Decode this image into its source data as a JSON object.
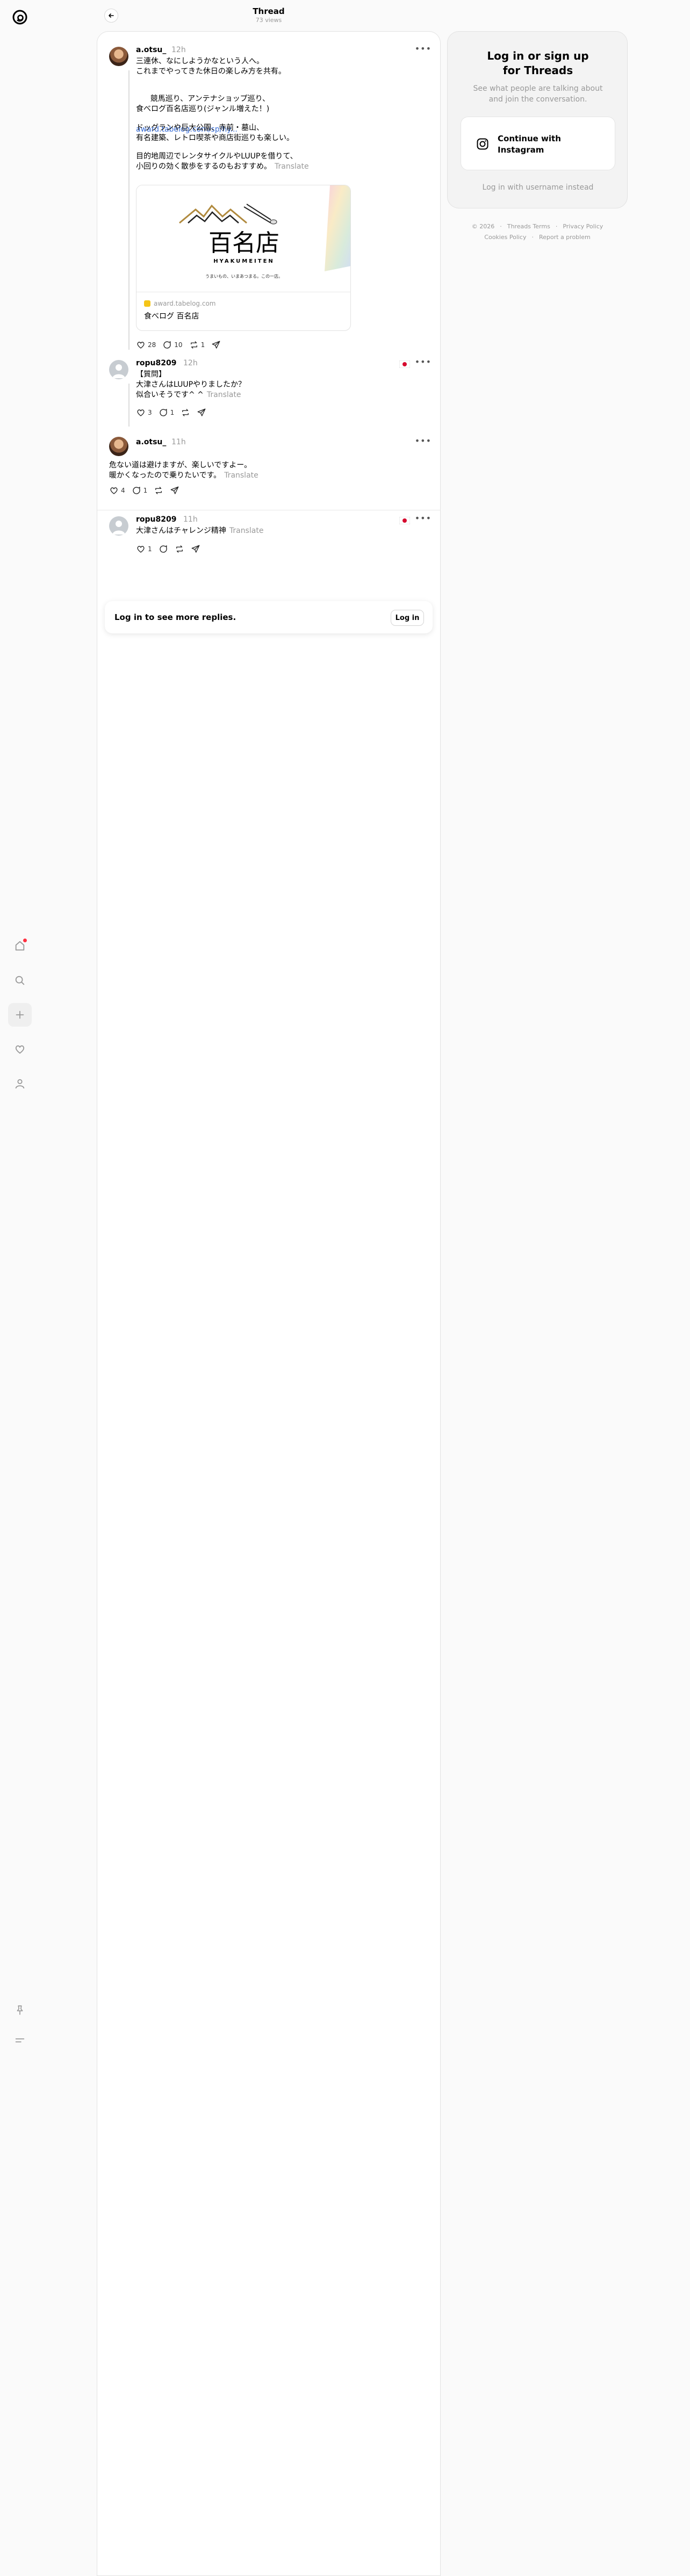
{
  "header": {
    "title": "Thread",
    "views": "73 views"
  },
  "rail": {
    "items": [
      "home-icon",
      "search-icon",
      "create-icon",
      "activity-icon",
      "profile-icon",
      "pin-icon",
      "menu-icon"
    ]
  },
  "posts": [
    {
      "username": "a.otsu_",
      "time": "12h",
      "paragraphs": [
        "三連休、なにしようかなという人へ。\nこれまでやってきた休日の楽しみ方を共有。",
        "競馬巡り、アンテナショップ巡り、\n食べログ百名店巡り(ジャンル増えた！)",
        "ドッグランや巨大公園、寺前・墓山、\n有名建築、レトロ喫茶や商店街巡りも楽しい。",
        "目的地周辺でレンタサイクルやLUUPを借りて、\n小回りの効く散歩をするのもおすすめ。"
      ],
      "link": "award.tabelog.com/sp/hy...",
      "translate": "Translate",
      "preview": {
        "domain": "award.tabelog.com",
        "title": "食べログ 百名店",
        "image_title": "百名店",
        "image_romaji": "HYAKUMEITEN",
        "image_tagline": "うまいもの、いまあつまる。この一店。"
      },
      "likes": "28",
      "replies": "10",
      "reposts": "1"
    },
    {
      "username": "ropu8209",
      "time": "12h",
      "text": "【質問】\n大津さんはLUUPやりましたか？\n似合いそうです^ ^",
      "translate": "Translate",
      "likes": "3",
      "replies": "1",
      "reposts": ""
    },
    {
      "username": "a.otsu_",
      "time": "11h",
      "text": "危ない道は避けますが、楽しいですよー。\n暖かくなったので乗りたいです。",
      "translate": "Translate",
      "likes": "4",
      "replies": "1",
      "reposts": ""
    },
    {
      "username": "ropu8209",
      "time": "11h",
      "text": "大津さんはチャレンジ精神",
      "translate": "Translate",
      "likes": "1",
      "replies": "",
      "reposts": ""
    }
  ],
  "login_prompt": {
    "text": "Log in to see more replies.",
    "button": "Log in"
  },
  "side_panel": {
    "title": "Log in or sign up\nfor Threads",
    "subtitle": "See what people are talking about\nand join the conversation.",
    "instagram_button": "Continue with\nInstagram",
    "alt_login": "Log in with username instead"
  },
  "footer": {
    "copyright": "© 2026",
    "terms": "Threads Terms",
    "privacy": "Privacy Policy",
    "cookies": "Cookies Policy",
    "report": "Report a problem"
  }
}
